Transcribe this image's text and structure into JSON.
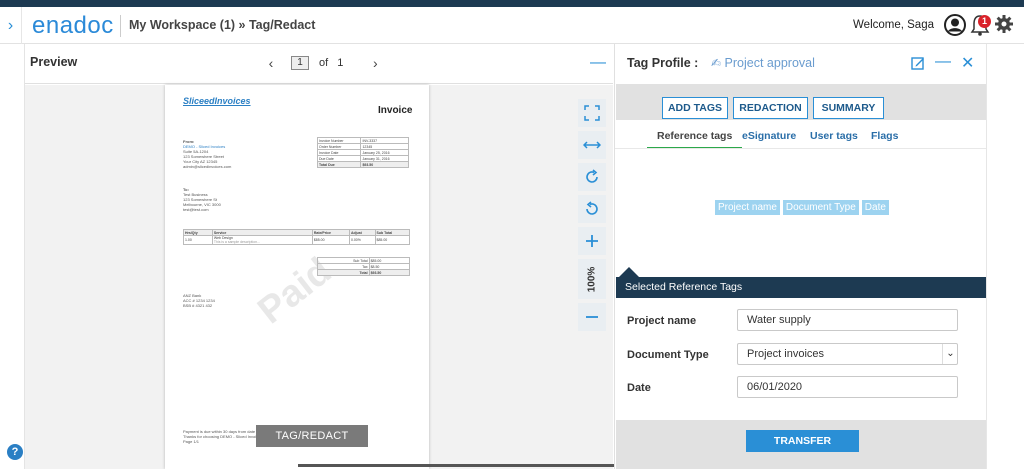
{
  "app": {
    "logo": "enadoc",
    "breadcrumb": "My Workspace (1) » Tag/Redact"
  },
  "header": {
    "welcome": "Welcome,  Saga",
    "notification_count": "1"
  },
  "preview": {
    "title": "Preview",
    "page_current": "1",
    "page_of": "of",
    "page_total": "1",
    "zoom": "100%",
    "tag_redact_label": "TAG/REDACT"
  },
  "document": {
    "logo": "SliceedInvoices",
    "title": "Invoice",
    "watermark": "Paid",
    "from_lines": [
      "From:",
      "DEMO - Sliced Invoices",
      "Suite 5A-1204",
      "123 Somewhere Street",
      "Your City AZ 12345",
      "admin@slicedinvoices.com"
    ],
    "to_lines": [
      "To:",
      "Test Business",
      "123 Somewhere St",
      "Melbourne, VIC 3000",
      "test@test.com"
    ],
    "meta": [
      [
        "Invoice Number",
        "INV-3337"
      ],
      [
        "Order Number",
        "12345"
      ],
      [
        "Invoice Date",
        "January 25, 2016"
      ],
      [
        "Due Date",
        "January 31, 2016"
      ],
      [
        "Total Due",
        "$93.50"
      ]
    ],
    "items_header": [
      "Hrs/Qty",
      "Service",
      "Rate/Price",
      "Adjust",
      "Sub Total"
    ],
    "items_row": [
      "1.00",
      "Web Design",
      "$85.00",
      "0.00%",
      "$85.00"
    ],
    "item_desc": "This is a sample description...",
    "totals": [
      [
        "Sub Total",
        "$85.00"
      ],
      [
        "Tax",
        "$8.50"
      ],
      [
        "Total",
        "$93.50"
      ]
    ],
    "bank_lines": [
      "ANZ Bank",
      "ACC # 1234 1234",
      "BSB # 4321 432"
    ],
    "footer_lines": [
      "Payment is due within 30 days from date of invoice. Late payment is subject to fees of 5% per month.",
      "Thanks for choosing DEMO - Sliced Invoices | admin@slicedinvoices.com",
      "Page 1/1"
    ]
  },
  "tag_panel": {
    "title": "Tag Profile :",
    "profile_name": "Project approval",
    "tabs": [
      "ADD TAGS",
      "REDACTION",
      "SUMMARY"
    ],
    "subtabs": [
      "Reference tags",
      "eSignature",
      "User tags",
      "Flags"
    ],
    "chips": [
      "Project name",
      "Document Type",
      "Date"
    ],
    "selected_header": "Selected Reference Tags",
    "fields": [
      {
        "label": "Project name",
        "value": "Water supply"
      },
      {
        "label": "Document Type",
        "value": "Project invoices"
      },
      {
        "label": "Date",
        "value": "06/01/2020"
      }
    ],
    "transfer_label": "TRANSFER"
  },
  "colors": {
    "brand": "#2b8ad8",
    "navy": "#1d3a52",
    "chip": "#9dd3f0",
    "badge": "#d9222a",
    "active_tab": "#2ca84a"
  },
  "icons": [
    "chevron-right-icon",
    "user-icon",
    "bell-icon",
    "gear-icon",
    "fit-page-icon",
    "fit-width-icon",
    "rotate-right-icon",
    "rotate-left-icon",
    "zoom-in-icon",
    "zoom-out-icon",
    "edit-icon",
    "minimize-icon",
    "close-icon",
    "signature-icon",
    "help-icon"
  ]
}
